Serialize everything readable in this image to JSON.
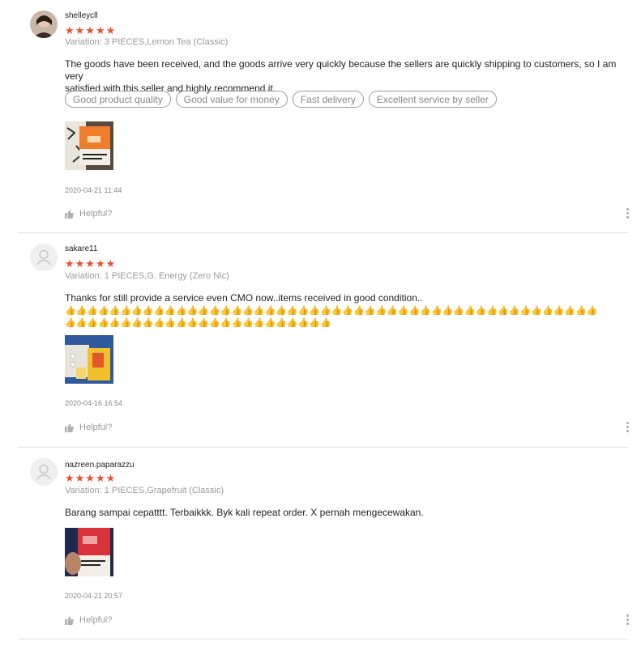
{
  "reviews": [
    {
      "username": "shelleycll",
      "rating_stars": "★★★★★",
      "rating": 5,
      "variation": "Variation: 3 PIECES,Lemon Tea (Classic)",
      "comment_lines": [
        "The goods have been received, and the goods arrive very quickly because the sellers are quickly shipping to customers, so I am very",
        "satisfied with this seller and highly recommend it."
      ],
      "tags": [
        "Good product quality",
        "Good value for money",
        "Fast delivery",
        "Excellent service by seller"
      ],
      "date": "2020-04-21 11:44",
      "helpful_label": "Helpful?"
    },
    {
      "username": "sakare11",
      "rating_stars": "★★★★★",
      "rating": 5,
      "variation": "Variation: 1 PIECES,G. Energy (Zero Nic)",
      "comment_lines": [
        "Thanks for still provide a service even CMO now..items received in good condition..",
        "👍👍👍👍👍👍👍👍👍👍👍👍👍👍👍👍👍👍👍👍👍👍👍👍👍👍👍👍👍👍👍👍👍👍👍👍👍👍👍👍👍👍👍👍👍👍👍👍",
        "👍👍👍👍👍👍👍👍👍👍👍👍👍👍👍👍👍👍👍👍👍👍👍👍"
      ],
      "tags": [],
      "date": "2020-04-16 16:54",
      "helpful_label": "Helpful?"
    },
    {
      "username": "nazreen.paparazzu",
      "rating_stars": "★★★★★",
      "rating": 5,
      "variation": "Variation: 1 PIECES,Grapefruit (Classic)",
      "comment_lines": [
        "Barang sampai cepatttt. Terbaikkk. Byk kali repeat order. X pernah mengecewakan."
      ],
      "tags": [],
      "date": "2020-04-21 20:57",
      "helpful_label": "Helpful?"
    }
  ],
  "icons": {
    "thumb": "thumbs-up-icon",
    "more": "more-vertical-icon",
    "default_avatar": "user-placeholder-icon"
  },
  "colors": {
    "star": "#ee4d2d",
    "muted_text": "#9a9a9a",
    "divider": "#e5e5e5"
  }
}
